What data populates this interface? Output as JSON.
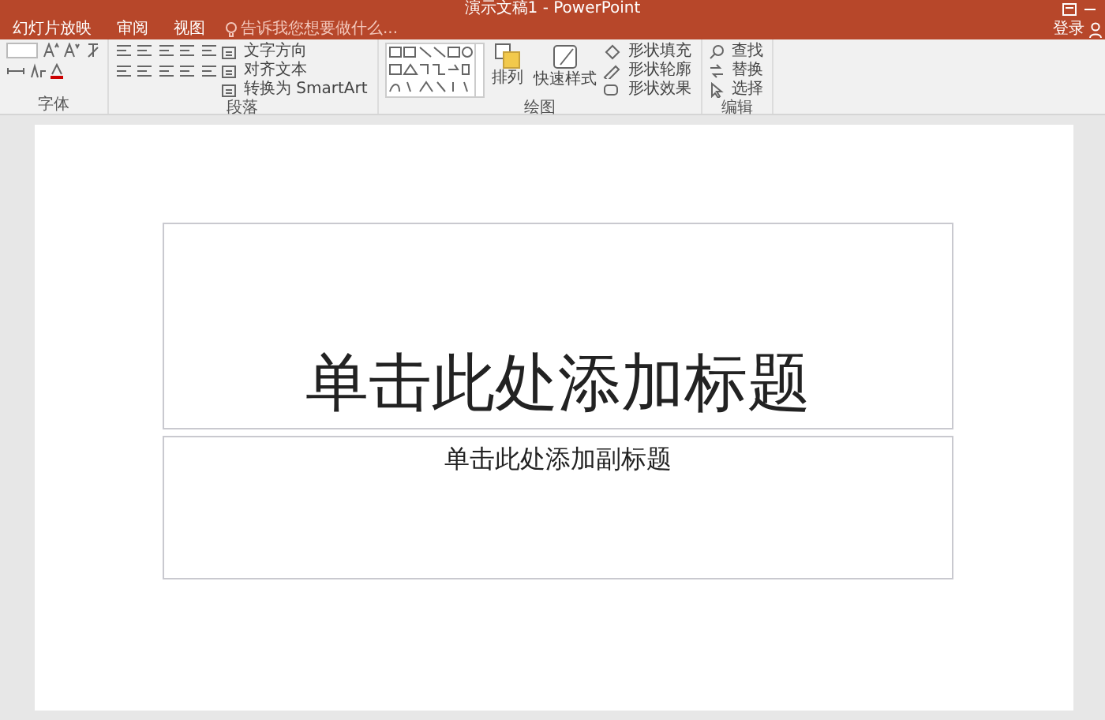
{
  "window": {
    "title": "演示文稿1 - PowerPoint",
    "sign_in": "登录"
  },
  "tabs": [
    {
      "label": "幻灯片放映",
      "selected": false
    },
    {
      "label": "审阅",
      "selected": false
    },
    {
      "label": "视图",
      "selected": false
    }
  ],
  "tell_me": {
    "placeholder": "告诉我您想要做什么..."
  },
  "ribbon": {
    "groups": [
      {
        "kind": "font",
        "label": "字体"
      },
      {
        "kind": "paragraph",
        "label": "段落",
        "buttons": [
          "文字方向",
          "对齐文本",
          "转换为 SmartArt"
        ]
      },
      {
        "kind": "drawing",
        "label": "绘图",
        "buttons": [
          "排列",
          "快速样式",
          "形状填充",
          "形状轮廓",
          "形状效果"
        ]
      },
      {
        "kind": "editing",
        "label": "编辑",
        "buttons": [
          "查找",
          "替换",
          "选择"
        ]
      }
    ]
  },
  "slide": {
    "title_placeholder": "单击此处添加标题",
    "subtitle_placeholder": "单击此处添加副标题"
  }
}
